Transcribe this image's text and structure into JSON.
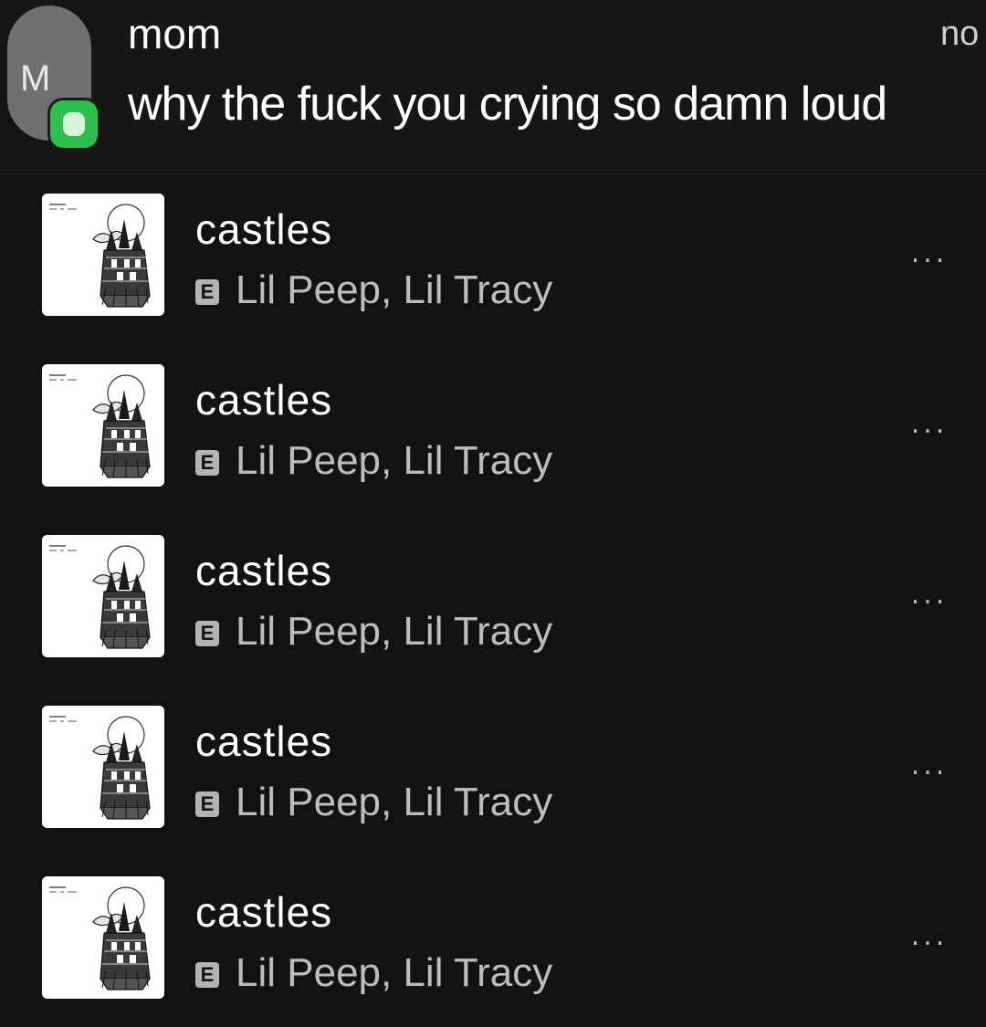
{
  "notification": {
    "avatar_letter": "M",
    "sender": "mom",
    "message": "why the fuck you crying so damn loud",
    "time": "no",
    "app_icon": "messages-icon",
    "app_color": "#2fbf4f"
  },
  "tracks": [
    {
      "title": "castles",
      "explicit_label": "E",
      "artists": "Lil Peep, Lil Tracy",
      "more_label": "..."
    },
    {
      "title": "castles",
      "explicit_label": "E",
      "artists": "Lil Peep, Lil Tracy",
      "more_label": "..."
    },
    {
      "title": "castles",
      "explicit_label": "E",
      "artists": "Lil Peep, Lil Tracy",
      "more_label": "..."
    },
    {
      "title": "castles",
      "explicit_label": "E",
      "artists": "Lil Peep, Lil Tracy",
      "more_label": "..."
    },
    {
      "title": "castles",
      "explicit_label": "E",
      "artists": "Lil Peep, Lil Tracy",
      "more_label": "..."
    }
  ],
  "colors": {
    "background": "#121212",
    "primary_text": "#ffffff",
    "secondary_text": "#bdbdbd"
  }
}
